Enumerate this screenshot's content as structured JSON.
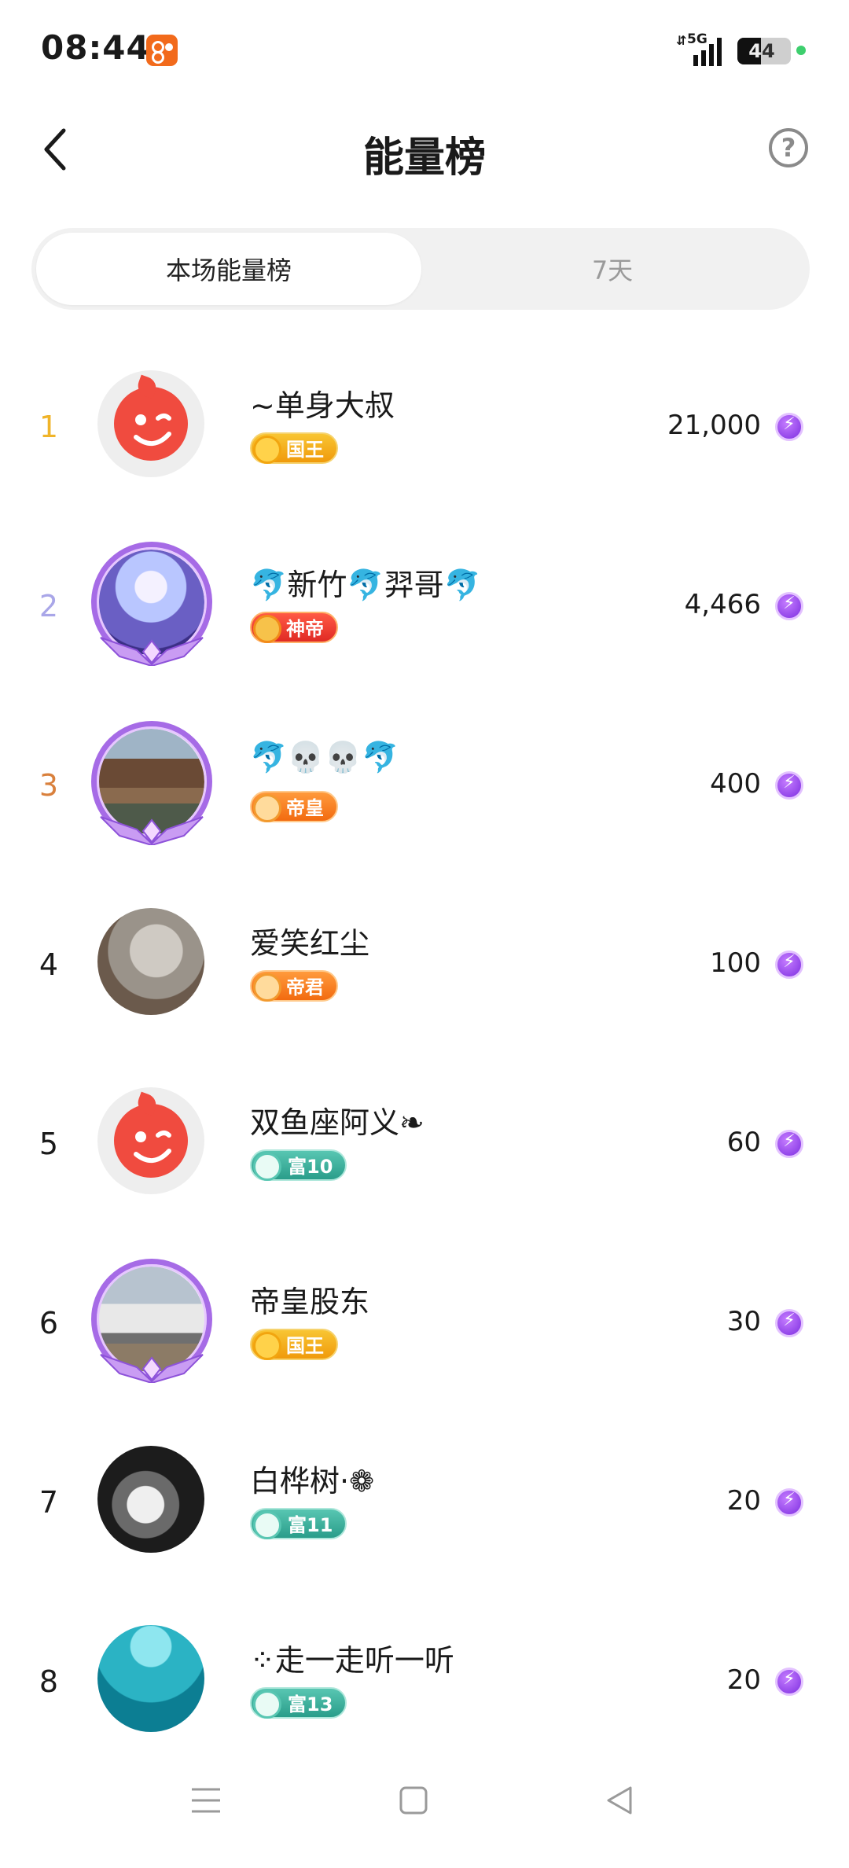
{
  "status_bar": {
    "time": "08:44",
    "network": "5G",
    "battery": "44",
    "battery_level": 0.44
  },
  "header": {
    "title": "能量榜",
    "back_icon": "chevron-left-icon",
    "help_icon": "question-circle-icon",
    "help_glyph": "?"
  },
  "tabs": [
    {
      "label": "本场能量榜",
      "active": true
    },
    {
      "label": "7天",
      "active": false
    }
  ],
  "leaderboard": [
    {
      "rank": "1",
      "rank_color": "#f0b429",
      "name": "~单身大叔",
      "badge": "国王",
      "badge_style": "gold",
      "score": "21,000",
      "avatar": "default-app-avatar",
      "frame": false
    },
    {
      "rank": "2",
      "rank_color": "#a9a6e8",
      "name": "🐬新竹🐬羿哥🐬",
      "badge": "神帝",
      "badge_style": "red",
      "score": "4,466",
      "avatar": "anime-character-avatar",
      "frame": true
    },
    {
      "rank": "3",
      "rank_color": "#d9803c",
      "name": "🐬💀💀🐬",
      "badge": "帝皇",
      "badge_style": "orange",
      "score": "400",
      "avatar": "village-photo-avatar",
      "frame": true
    },
    {
      "rank": "4",
      "rank_color": "#1a1a1a",
      "name": "爱笑红尘",
      "badge": "帝君",
      "badge_style": "orange",
      "score": "100",
      "avatar": "cat-photo-avatar",
      "frame": false
    },
    {
      "rank": "5",
      "rank_color": "#1a1a1a",
      "name": "双鱼座阿义❧",
      "badge": "富10",
      "badge_style": "teal",
      "score": "60",
      "avatar": "default-app-avatar",
      "frame": false
    },
    {
      "rank": "6",
      "rank_color": "#1a1a1a",
      "name": "帝皇股东",
      "badge": "国王",
      "badge_style": "gold",
      "score": "30",
      "avatar": "car-photo-avatar",
      "frame": true
    },
    {
      "rank": "7",
      "rank_color": "#1a1a1a",
      "name": "白桦树·❁",
      "badge": "富11",
      "badge_style": "teal",
      "score": "20",
      "avatar": "bw-portrait-avatar",
      "frame": false
    },
    {
      "rank": "8",
      "rank_color": "#1a1a1a",
      "name": "⁘走一走听一听",
      "badge": "富13",
      "badge_style": "teal",
      "score": "20",
      "avatar": "underwater-avatar",
      "frame": false
    }
  ],
  "nav_bar": {
    "menu_icon": "menu-icon",
    "home_icon": "home-square-icon",
    "back_icon": "back-triangle-icon"
  },
  "colors": {
    "accent_purple": "#7d2fe0",
    "tab_bg": "#f1f1f1",
    "tab_inactive_text": "#9a9a9a"
  }
}
